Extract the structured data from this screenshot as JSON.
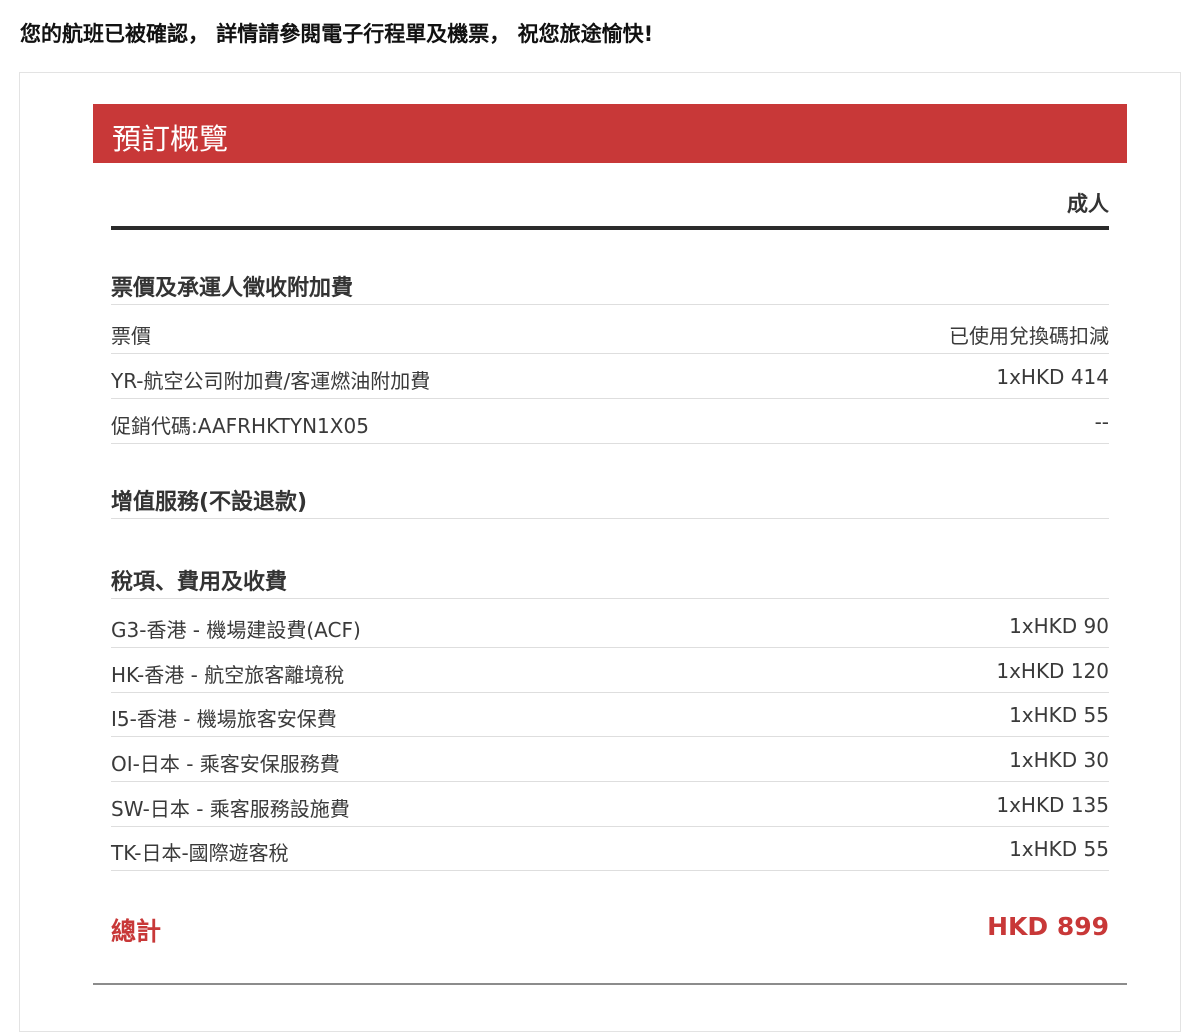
{
  "confirmation_message": "您的航班已被確認， 詳情請參閱電子行程單及機票， 祝您旅途愉快!",
  "summary": {
    "title": "預訂概覽",
    "passenger_type": "成人"
  },
  "fare_section": {
    "title": "票價及承運人徵收附加費",
    "rows": [
      {
        "label": "票價",
        "value": "已使用兌換碼扣減"
      },
      {
        "label": "YR-航空公司附加費/客運燃油附加費",
        "value": "1xHKD 414"
      },
      {
        "label": "促銷代碼:AAFRHKTYN1X05",
        "value": "--"
      }
    ]
  },
  "addon_section": {
    "title": "增值服務(不設退款)"
  },
  "tax_section": {
    "title": "稅項、費用及收費",
    "rows": [
      {
        "label": "G3-香港 - 機場建設費(ACF)",
        "value": "1xHKD 90"
      },
      {
        "label": "HK-香港 - 航空旅客離境稅",
        "value": "1xHKD 120"
      },
      {
        "label": "I5-香港 - 機場旅客安保費",
        "value": "1xHKD 55"
      },
      {
        "label": "OI-日本 - 乘客安保服務費",
        "value": "1xHKD 30"
      },
      {
        "label": "SW-日本 - 乘客服務設施費",
        "value": "1xHKD 135"
      },
      {
        "label": "TK-日本-國際遊客稅",
        "value": "1xHKD 55"
      }
    ]
  },
  "total": {
    "label": "總計",
    "value": "HKD 899"
  },
  "colors": {
    "accent": "#c83838",
    "text": "#333333",
    "divider": "#dedede"
  }
}
